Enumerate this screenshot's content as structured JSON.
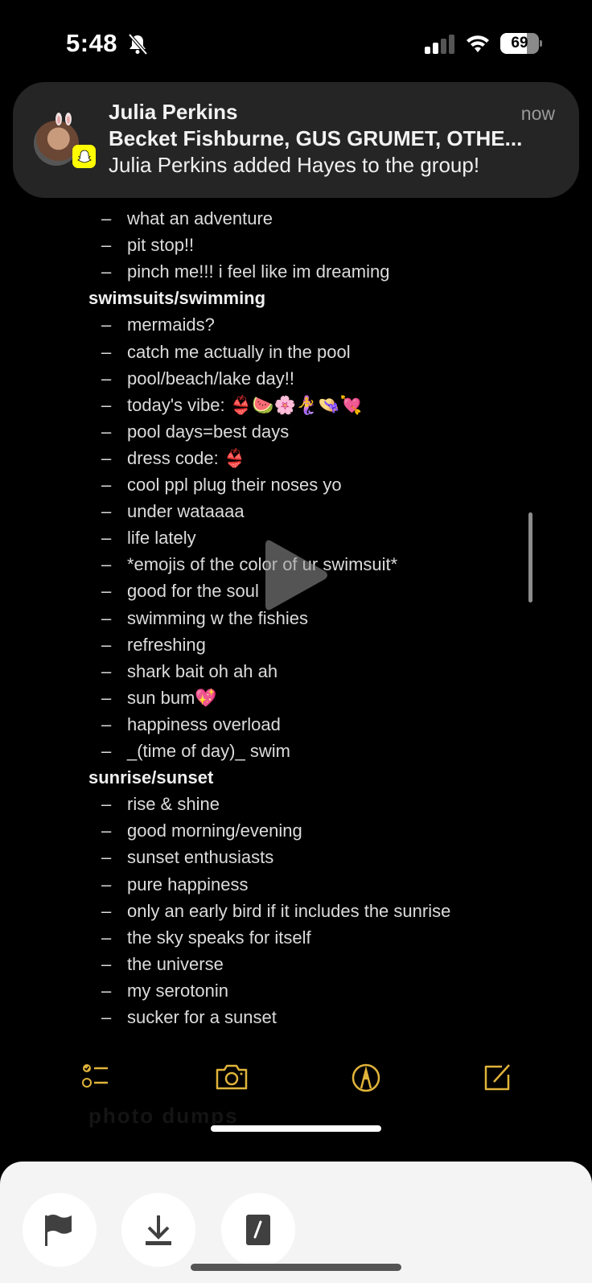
{
  "status_bar": {
    "time": "5:48",
    "silent_icon": "bell-slash-icon",
    "signal_bars_active": 2,
    "signal_bars_total": 4,
    "wifi_icon": "wifi-icon",
    "battery_percent": "69",
    "battery_level": 0.69
  },
  "notification": {
    "app_icon": "snapchat-ghost-icon",
    "sender": "Julia Perkins",
    "time": "now",
    "title": "Becket Fishburne, GUS GRUMET, OTHE...",
    "body": "Julia Perkins added Hayes to the group!"
  },
  "note": {
    "top_items": [
      "what an adventure",
      "pit stop!!",
      "pinch me!!! i feel like im dreaming"
    ],
    "sections": [
      {
        "heading": "swimsuits/swimming",
        "items": [
          "mermaids?",
          "catch me actually  in the pool",
          "pool/beach/lake day!!",
          "today's vibe: 👙🍉🌸🧜‍♀️👒💘",
          "pool days=best days",
          "dress code: 👙",
          "cool ppl plug their noses yo",
          "under wataaaa",
          "life lately",
          "*emojis of the color of ur swimsuit*",
          "good for the soul",
          "swimming w the fishies",
          "refreshing",
          "shark bait oh ah ah",
          "sun bum💖",
          "happiness overload",
          "_(time of day)_ swim"
        ]
      },
      {
        "heading": "sunrise/sunset",
        "items": [
          "rise & shine",
          "good morning/evening",
          "sunset enthusiasts",
          "pure happiness",
          "only an early bird if it includes the sunrise",
          "the sky speaks for itself",
          "the universe",
          "my serotonin",
          "sucker for a sunset"
        ]
      }
    ],
    "dash": "–",
    "ghost_heading": "photo dumps"
  },
  "toolbar": {
    "accent": "#e0b43a",
    "buttons": [
      "checklist",
      "camera",
      "markup",
      "compose"
    ]
  },
  "bottom_sheet": {
    "buttons": [
      "flag",
      "download",
      "edit"
    ]
  }
}
